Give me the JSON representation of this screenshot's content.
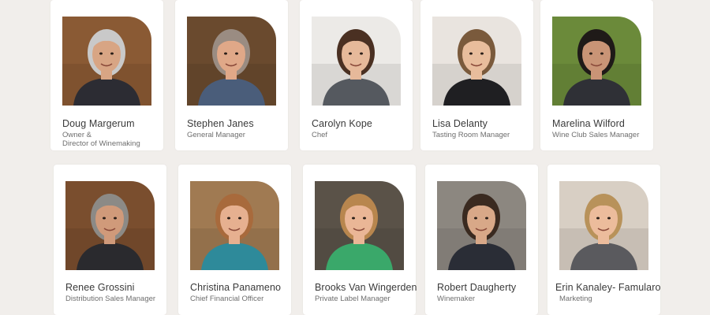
{
  "team": [
    {
      "name": "Doug Margerum",
      "role_lines": [
        "Owner &",
        "Director of Winemaking"
      ],
      "bg": "#8a5a34",
      "hair": "#c9c9c9",
      "skin": "#d8a584",
      "shirt": "#2c2c33"
    },
    {
      "name": "Stephen Janes",
      "role_lines": [
        "General Manager"
      ],
      "bg": "#6a4a2e",
      "hair": "#9a8c82",
      "skin": "#e0a888",
      "shirt": "#4a5d7a"
    },
    {
      "name": "Carolyn Kope",
      "role_lines": [
        "Chef"
      ],
      "bg": "#eceae7",
      "hair": "#4a3022",
      "skin": "#e6b99a",
      "shirt": "#55595f"
    },
    {
      "name": "Lisa Delanty",
      "role_lines": [
        "Tasting Room Manager"
      ],
      "bg": "#e9e4df",
      "hair": "#7a5a3c",
      "skin": "#e8bd9c",
      "shirt": "#1f1f22"
    },
    {
      "name": "Marelina Wilford",
      "role_lines": [
        "Wine Club Sales Manager"
      ],
      "bg": "#6b8a3a",
      "hair": "#1f1a18",
      "skin": "#c99476",
      "shirt": "#2f3036"
    },
    {
      "name": "Renee Grossini",
      "role_lines": [
        "Distribution Sales Manager"
      ],
      "bg": "#7a4e2e",
      "hair": "#8c8a86",
      "skin": "#d09a7a",
      "shirt": "#2a2a2e"
    },
    {
      "name": "Christina Panameno",
      "role_lines": [
        "Chief Financial Officer"
      ],
      "bg": "#a07a52",
      "hair": "#a86a3c",
      "skin": "#e6b090",
      "shirt": "#2e8a9a"
    },
    {
      "name": "Brooks Van Wingerden",
      "role_lines": [
        "Private Label Manager"
      ],
      "bg": "#5a5248",
      "hair": "#b8864e",
      "skin": "#eab696",
      "shirt": "#3aa86a"
    },
    {
      "name": "Robert Daugherty",
      "role_lines": [
        "Winemaker"
      ],
      "bg": "#8c8780",
      "hair": "#3a2a20",
      "skin": "#d8a888",
      "shirt": "#2a2d36"
    },
    {
      "name": "Erin Kanaley- Famularo",
      "role_lines": [
        "Marketing"
      ],
      "bg": "#d8cfc4",
      "hair": "#b8925a",
      "skin": "#ecbc9c",
      "shirt": "#5a5a5e"
    }
  ]
}
